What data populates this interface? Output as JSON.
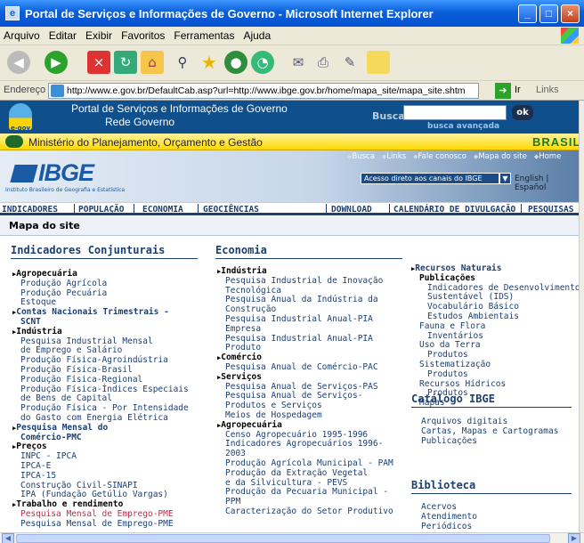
{
  "window": {
    "title": "Portal de Serviços e Informações de Governo - Microsoft Internet Explorer"
  },
  "menu": [
    "Arquivo",
    "Editar",
    "Exibir",
    "Favoritos",
    "Ferramentas",
    "Ajuda"
  ],
  "address": {
    "label": "Endereço",
    "url": "http://www.e.gov.br/DefaultCab.asp?url=http://www.ibge.gov.br/home/mapa_site/mapa_site.shtm",
    "go": "Ir",
    "links": "Links"
  },
  "gov": {
    "line1": "Portal de Serviços e Informações de Governo",
    "line2": "Rede Governo",
    "logo": "e-gov",
    "search_label": "Busca",
    "ok": "ok",
    "advanced": "busca avançada"
  },
  "ministry": {
    "text": "Ministério do Planejamento, Orçamento e Gestão",
    "brand": "BRASIL"
  },
  "ibge": {
    "logo": "IBGE",
    "subtitle": "Instituto Brasileiro de Geografia e Estatística",
    "toplinks": [
      "Busca",
      "Links",
      "Fale conosco",
      "Mapa do site",
      "Home"
    ],
    "acesso": "Acesso direto aos canais do IBGE",
    "lang_en": "English",
    "lang_es": "Español"
  },
  "nav": [
    "INDICADORES",
    "POPULAÇÃO",
    "ECONOMIA",
    "GEOCIÊNCIAS",
    "DOWNLOAD",
    "CALENDÁRIO DE DIVULGAÇÃO",
    "PESQUISAS"
  ],
  "page_title": "Mapa do site",
  "sections": {
    "indicadores": "Indicadores Conjunturais",
    "economia": "Economia",
    "catalogo": "Catálogo IBGE",
    "biblioteca": "Biblioteca"
  },
  "col1": [
    {
      "t": "h",
      "v": "Agropecuária"
    },
    {
      "t": "l",
      "v": "Produção Agrícola"
    },
    {
      "t": "l",
      "v": "Produção Pecuária"
    },
    {
      "t": "l",
      "v": "Estoque"
    },
    {
      "t": "h2",
      "v": "Contas Nacionais Trimestrais -"
    },
    {
      "t": "l2b",
      "v": "SCNT"
    },
    {
      "t": "h",
      "v": "Indústria"
    },
    {
      "t": "l",
      "v": "Pesquisa Industrial Mensal"
    },
    {
      "t": "l",
      "v": "de Emprego e Salário"
    },
    {
      "t": "l",
      "v": "Produção Física-Agroindústria"
    },
    {
      "t": "l",
      "v": "Produção Física-Brasil"
    },
    {
      "t": "l",
      "v": "Produção Física-Regional"
    },
    {
      "t": "l",
      "v": "Produção Física-Índices Especiais"
    },
    {
      "t": "l",
      "v": "de Bens de Capital"
    },
    {
      "t": "l",
      "v": "Produção Física - Por Intensidade"
    },
    {
      "t": "l",
      "v": "do Gasto com Energia Elétrica"
    },
    {
      "t": "h2",
      "v": "Pesquisa Mensal do"
    },
    {
      "t": "l2b",
      "v": "Comércio-PMC"
    },
    {
      "t": "h",
      "v": "Preços"
    },
    {
      "t": "l",
      "v": "INPC - IPCA"
    },
    {
      "t": "l",
      "v": "IPCA-E"
    },
    {
      "t": "l",
      "v": "IPCA-15"
    },
    {
      "t": "l",
      "v": "Construção Civil-SINAPI"
    },
    {
      "t": "l",
      "v": "IPA (Fundação Getúlio Vargas)"
    },
    {
      "t": "h",
      "v": "Trabalho e rendimento"
    },
    {
      "t": "r",
      "v": "Pesquisa Mensal de Emprego-PME"
    },
    {
      "t": "l",
      "v": "Pesquisa Mensal de Emprego-PME"
    }
  ],
  "col2": [
    {
      "t": "h",
      "v": "Indústria"
    },
    {
      "t": "l",
      "v": "Pesquisa Industrial de Inovação"
    },
    {
      "t": "l",
      "v": "Tecnológica"
    },
    {
      "t": "l",
      "v": "Pesquisa Anual da Indústria da"
    },
    {
      "t": "l",
      "v": "Construção"
    },
    {
      "t": "l",
      "v": "Pesquisa Industrial Anual-PIA"
    },
    {
      "t": "l",
      "v": "Empresa"
    },
    {
      "t": "l",
      "v": "Pesquisa Industrial Anual-PIA"
    },
    {
      "t": "l",
      "v": "Produto"
    },
    {
      "t": "h",
      "v": "Comércio"
    },
    {
      "t": "l",
      "v": "Pesquisa Anual de Comércio-PAC"
    },
    {
      "t": "h",
      "v": "Serviços"
    },
    {
      "t": "l",
      "v": "Pesquisa Anual de Serviços-PAS"
    },
    {
      "t": "l",
      "v": "Pesquisa Anual de Serviços-"
    },
    {
      "t": "l",
      "v": "Produtos e Serviços"
    },
    {
      "t": "l",
      "v": "Meios de Hospedagem"
    },
    {
      "t": "h",
      "v": "Agropecuária"
    },
    {
      "t": "l",
      "v": "Censo Agropecuário 1995-1996"
    },
    {
      "t": "l",
      "v": "Indicadores Agropecuários 1996-"
    },
    {
      "t": "l",
      "v": "2003"
    },
    {
      "t": "l",
      "v": "Produção Agrícola Municipal - PAM"
    },
    {
      "t": "l",
      "v": "Produção da Extração Vegetal"
    },
    {
      "t": "l",
      "v": "e da Silvicultura - PEVS"
    },
    {
      "t": "l",
      "v": "Produção da Pecuaria Municipal -"
    },
    {
      "t": "l",
      "v": "PPM"
    },
    {
      "t": "l",
      "v": "Caracterização do Setor Produtivo"
    }
  ],
  "col3": [
    {
      "t": "h2",
      "v": "Recursos Naturais"
    },
    {
      "t": "b",
      "v": "Publicações"
    },
    {
      "t": "ll",
      "v": "Indicadores de Desenvolvimento"
    },
    {
      "t": "ll",
      "v": "Sustentável (IDS)"
    },
    {
      "t": "ll",
      "v": "Vocabulário Básico"
    },
    {
      "t": "ll",
      "v": "Estudos Ambientais"
    },
    {
      "t": "l",
      "v": "Fauna e Flora"
    },
    {
      "t": "ll",
      "v": "Inventários"
    },
    {
      "t": "l",
      "v": "Uso da Terra"
    },
    {
      "t": "ll",
      "v": "Produtos"
    },
    {
      "t": "l",
      "v": "Sistematização"
    },
    {
      "t": "ll",
      "v": "Produtos"
    },
    {
      "t": "l",
      "v": "Recursos Hídricos"
    },
    {
      "t": "ll",
      "v": "Produtos"
    },
    {
      "t": "l",
      "v": "Mapas"
    }
  ],
  "catalogo_items": [
    "Arquivos digitais",
    "Cartas, Mapas e Cartogramas",
    "Publicações"
  ],
  "biblioteca_items": [
    "Acervos",
    "Atendimento",
    "Periódicos"
  ]
}
